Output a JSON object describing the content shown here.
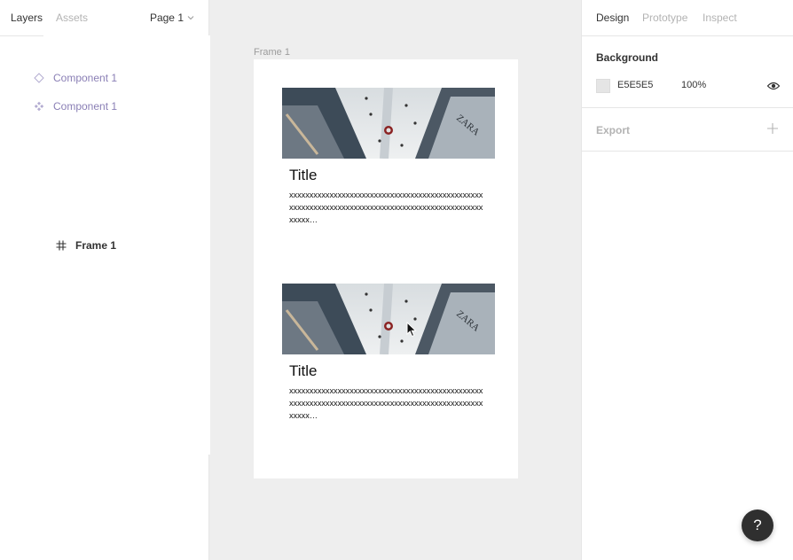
{
  "left_panel": {
    "tabs": [
      {
        "label": "Layers",
        "active": true
      },
      {
        "label": "Assets",
        "active": false
      }
    ],
    "page_selector": "Page 1",
    "layers": [
      {
        "label": "Frame 1",
        "type": "frame",
        "icon": "frame-hash-icon"
      },
      {
        "label": "Component 1",
        "type": "instance",
        "icon": "instance-diamond-icon"
      },
      {
        "label": "Component 1",
        "type": "component",
        "icon": "component-icon"
      }
    ]
  },
  "canvas": {
    "frame_label": "Frame 1",
    "cards": [
      {
        "title": "Title",
        "body": "xxxxxxxxxxxxxxxxxxxxxxxxxxxxxxxxxxxxxxxxxxxxxxxxxxxxxxxxxxxxxxxxxxxxxxxxxxxxxxxxxxxxxxxxxxxxxxxxxxxxx…",
        "image": "mall-photo-zara"
      },
      {
        "title": "Title",
        "body": "xxxxxxxxxxxxxxxxxxxxxxxxxxxxxxxxxxxxxxxxxxxxxxxxxxxxxxxxxxxxxxxxxxxxxxxxxxxxxxxxxxxxxxxxxxxxxxxxxxxxx…",
        "image": "mall-photo-zara"
      }
    ],
    "background_color": "#eeeeee"
  },
  "right_panel": {
    "tabs": [
      {
        "label": "Design",
        "active": true
      },
      {
        "label": "Prototype",
        "active": false
      },
      {
        "label": "Inspect",
        "active": false
      }
    ],
    "background": {
      "title": "Background",
      "hex": "E5E5E5",
      "opacity": "100%",
      "swatch_color": "#e5e5e5"
    },
    "export": {
      "title": "Export"
    }
  },
  "help_button": "?"
}
